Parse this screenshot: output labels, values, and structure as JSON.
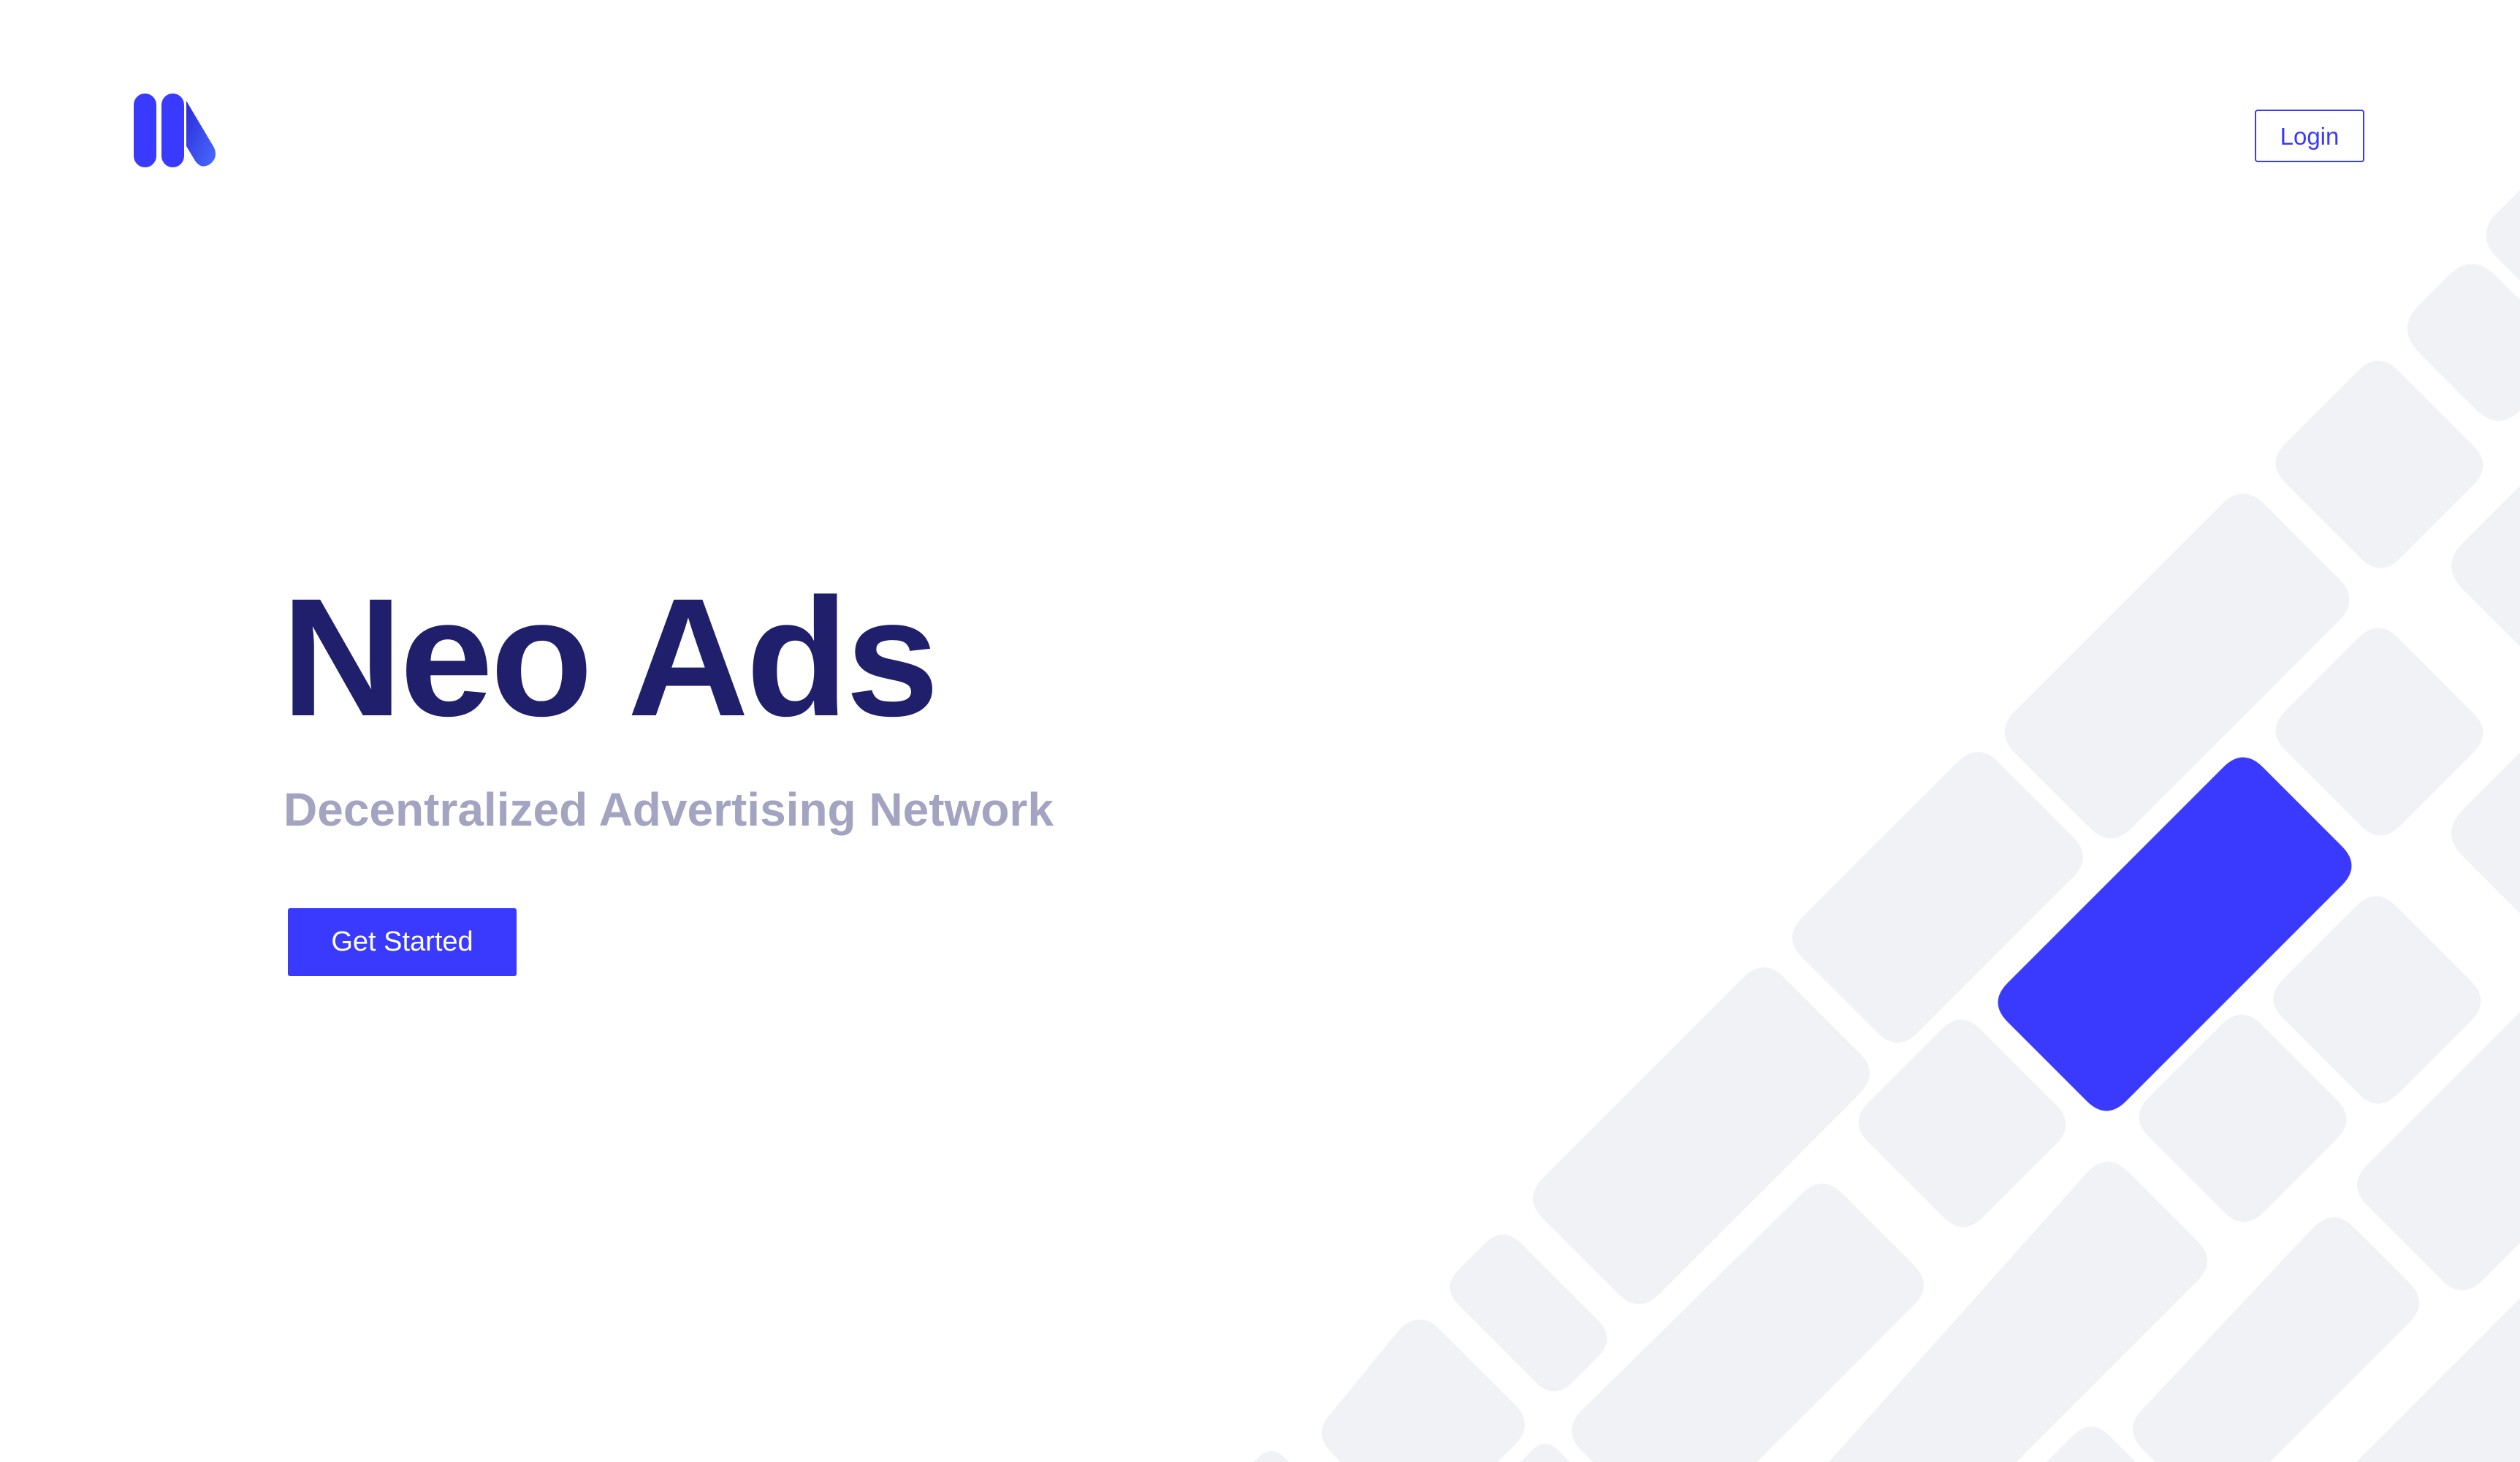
{
  "header": {
    "logo_name": "neo-ads-logo",
    "login_label": "Login"
  },
  "hero": {
    "title": "Neo Ads",
    "subtitle": "Decentralized Advertising Network",
    "cta_label": "Get Started"
  },
  "colors": {
    "brand": "#3a3aff",
    "title": "#1f1f6b",
    "subtitle": "#a3a3c2",
    "tile": "#f1f2f5",
    "background": "#ffffff"
  }
}
